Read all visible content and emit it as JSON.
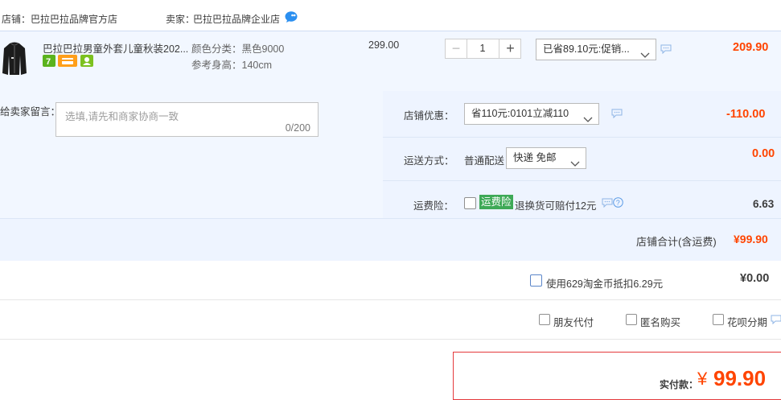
{
  "shop": {
    "store_label": "店铺：",
    "store_name": "巴拉巴拉品牌官方店",
    "seller_label": "卖家：",
    "seller_name": "巴拉巴拉品牌企业店"
  },
  "item": {
    "title": "巴拉巴拉男童外套儿童秋装202...",
    "sku_color": "颜色分类：黑色9000",
    "sku_height": "参考身高：140cm",
    "unit_price": "299.00",
    "quantity": "1",
    "qty_minus": "−",
    "qty_plus": "+",
    "promo_select": "已省89.10元:促销...",
    "subtotal": "209.90",
    "badges": [
      "seven-day-return-badge",
      "card-badge",
      "person-badge"
    ],
    "accent_colors": {
      "green": "#5bb31d",
      "orange": "#ff9900",
      "red": "#ff4400"
    }
  },
  "note": {
    "label": "给卖家留言：",
    "placeholder": "选填,请先和商家协商一致",
    "counter": "0/200"
  },
  "discount": {
    "label": "店铺优惠：",
    "select_value": "省110元:0101立减110",
    "amount": "-110.00"
  },
  "shipping": {
    "label": "运送方式：",
    "method": "普通配送",
    "select_value": "快递 免邮",
    "amount": "0.00"
  },
  "insurance": {
    "label": "运费险：",
    "tag": "运费险",
    "desc": "退换货可赔付12元",
    "amount": "6.63"
  },
  "store_total": {
    "label": "店铺合计(含运费)",
    "amount": "¥99.90"
  },
  "coins": {
    "label": "使用629淘金币抵扣6.29元",
    "amount": "¥0.00"
  },
  "options": {
    "friend_pay": "朋友代付",
    "anonymous": "匿名购买",
    "installment": "花呗分期"
  },
  "payment": {
    "label": "实付款：",
    "currency": "¥",
    "amount": "99.90"
  }
}
